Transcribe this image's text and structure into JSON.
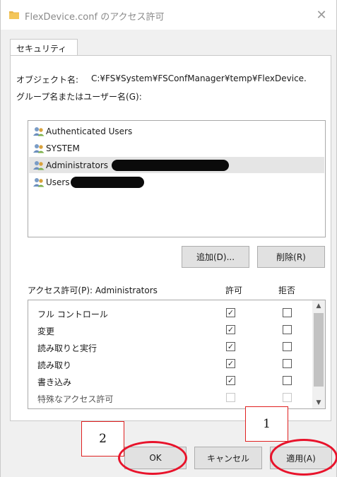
{
  "window": {
    "title": "FlexDevice.conf のアクセス許可",
    "close_glyph": "✕"
  },
  "tabs": [
    {
      "label": "セキュリティ"
    }
  ],
  "object": {
    "label": "オブジェクト名:",
    "value": "C:¥FS¥System¥FSConfManager¥temp¥FlexDevice."
  },
  "groups": {
    "label": "グループ名またはユーザー名(G):",
    "users": [
      {
        "name": "Authenticated Users",
        "icon": "users-group-icon"
      },
      {
        "name": "SYSTEM",
        "icon": "users-group-icon"
      },
      {
        "name": "Administrators",
        "icon": "users-group-icon",
        "selected": true
      },
      {
        "name": "Users",
        "icon": "users-group-icon"
      }
    ]
  },
  "buttons": {
    "add": "追加(D)...",
    "remove": "削除(R)",
    "ok": "OK",
    "cancel": "キャンセル",
    "apply": "適用(A)"
  },
  "permissions": {
    "header": "アクセス許可(P): Administrators",
    "allow_header": "許可",
    "deny_header": "拒否",
    "items": [
      {
        "name": "フル コントロール",
        "allow": true,
        "deny": false
      },
      {
        "name": "変更",
        "allow": true,
        "deny": false
      },
      {
        "name": "読み取りと実行",
        "allow": true,
        "deny": false
      },
      {
        "name": "読み取り",
        "allow": true,
        "deny": false
      },
      {
        "name": "書き込み",
        "allow": true,
        "deny": false
      },
      {
        "name": "特殊なアクセス許可",
        "allow": false,
        "deny": false
      }
    ]
  },
  "annotations": {
    "label_1": "1",
    "label_2": "2",
    "color": "#e8132b"
  },
  "colors": {
    "dialog_bg": "#f0f0f0",
    "selected_row": "#e5e5e5",
    "button_bg": "#e1e1e1"
  }
}
